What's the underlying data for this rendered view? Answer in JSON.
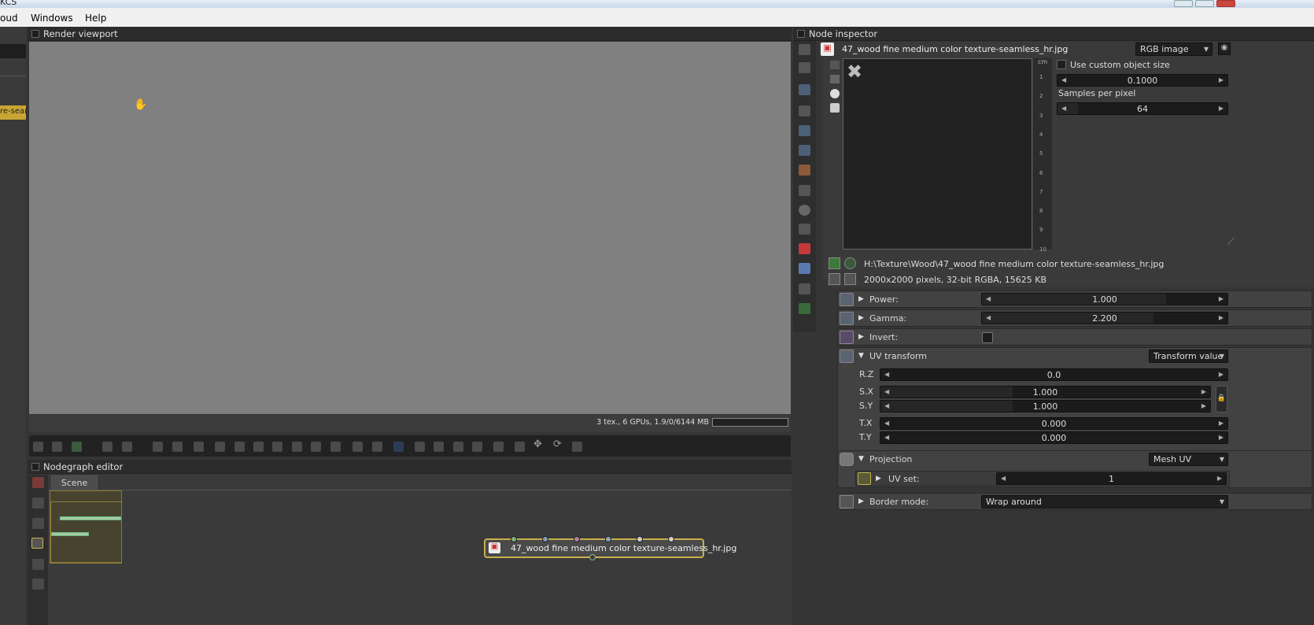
{
  "title_fragment": "KCS",
  "menu": [
    "oud",
    "Windows",
    "Help"
  ],
  "left_strip": {
    "tag": "re-sean"
  },
  "viewport": {
    "title": "Render viewport",
    "status": "3 tex., 6 GPUs, 1.9/0/6144 MB"
  },
  "nodegraph": {
    "title": "Nodegraph editor",
    "tab": "Scene",
    "node_label": "47_wood fine medium color texture-seamless_hr.jpg",
    "pin_colors": [
      "#7fb07f",
      "#7f9fb0",
      "#b07fa0",
      "#8fa8b8",
      "#d0d0d0",
      "#d0d0d0"
    ]
  },
  "inspector": {
    "title": "Node inspector",
    "node_name": "47_wood fine medium color texture-seamless_hr.jpg",
    "image_type": "RGB image",
    "ruler_unit": "cm",
    "ruler_ticks": [
      "1",
      "2",
      "3",
      "4",
      "5",
      "6",
      "7",
      "8",
      "9",
      "10"
    ],
    "use_custom_size_label": "Use custom object size",
    "size_value": "0.1000",
    "spp_label": "Samples per pixel",
    "spp_value": "64",
    "file_path": "H:\\Texture\\Wood\\47_wood fine medium color texture-seamless_hr.jpg",
    "file_info": "2000x2000 pixels, 32-bit RGBA, 15625 KB",
    "power": {
      "label": "Power:",
      "value": "1.000",
      "fill": 0.75
    },
    "gamma": {
      "label": "Gamma:",
      "value": "2.200",
      "fill": 0.7
    },
    "invert": {
      "label": "Invert:"
    },
    "uv_transform": {
      "label": "UV transform",
      "mode": "Transform value",
      "rz": {
        "label": "R.Z",
        "value": "0.0"
      },
      "sx": {
        "label": "S.X",
        "value": "1.000",
        "fill": 0.4
      },
      "sy": {
        "label": "S.Y",
        "value": "1.000",
        "fill": 0.4
      },
      "tx": {
        "label": "T.X",
        "value": "0.000"
      },
      "ty": {
        "label": "T.Y",
        "value": "0.000"
      }
    },
    "projection": {
      "label": "Projection",
      "mode": "Mesh UV"
    },
    "uv_set": {
      "label": "UV set:",
      "value": "1"
    },
    "border_mode": {
      "label": "Border mode:",
      "value": "Wrap around"
    }
  },
  "colors": {
    "accent": "#c8b04a",
    "viewport_bg": "#808080",
    "panel_bg": "#353535"
  }
}
